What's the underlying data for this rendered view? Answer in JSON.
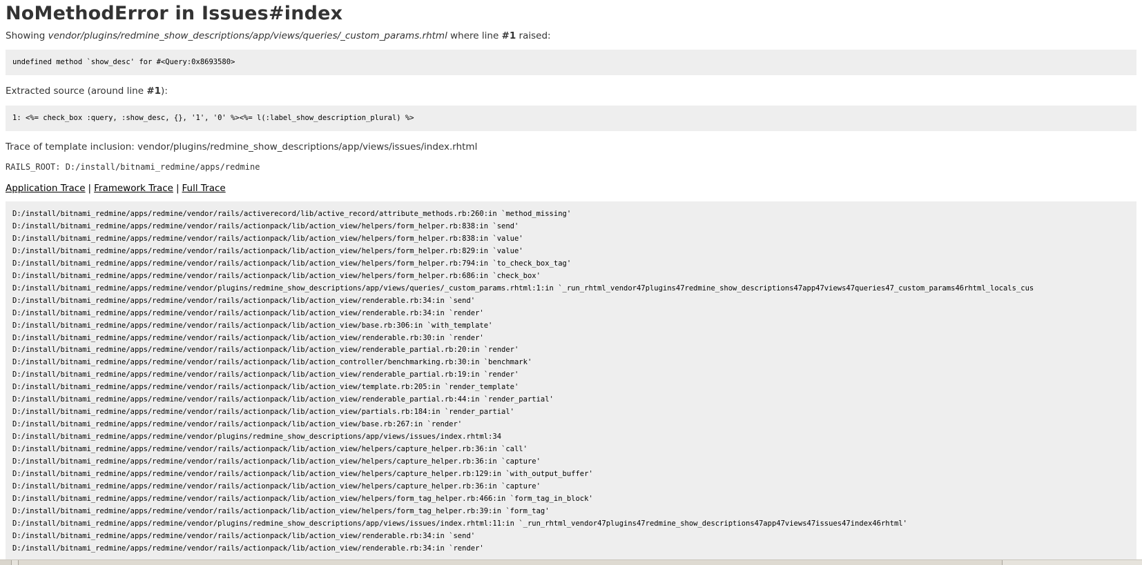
{
  "title": "NoMethodError in Issues#index",
  "showing": {
    "prefix": "Showing ",
    "path": "vendor/plugins/redmine_show_descriptions/app/views/queries/_custom_params.rhtml",
    "middle": " where line ",
    "line_no": "#1",
    "suffix": " raised:"
  },
  "error_message": "undefined method `show_desc' for #<Query:0x8693580>",
  "extracted": {
    "prefix": "Extracted source (around line ",
    "line_no": "#1",
    "suffix": "):"
  },
  "source_line": "1: <%= check_box :query, :show_desc, {}, '1', '0' %><%= l(:label_show_description_plural) %>",
  "template_inclusion": "Trace of template inclusion: vendor/plugins/redmine_show_descriptions/app/views/issues/index.rhtml",
  "rails_root": "RAILS_ROOT: D:/install/bitnami_redmine/apps/redmine",
  "links": {
    "application": "Application Trace",
    "framework": "Framework Trace",
    "full": "Full Trace",
    "separator": "|"
  },
  "trace": [
    "D:/install/bitnami_redmine/apps/redmine/vendor/rails/activerecord/lib/active_record/attribute_methods.rb:260:in `method_missing'",
    "D:/install/bitnami_redmine/apps/redmine/vendor/rails/actionpack/lib/action_view/helpers/form_helper.rb:838:in `send'",
    "D:/install/bitnami_redmine/apps/redmine/vendor/rails/actionpack/lib/action_view/helpers/form_helper.rb:838:in `value'",
    "D:/install/bitnami_redmine/apps/redmine/vendor/rails/actionpack/lib/action_view/helpers/form_helper.rb:829:in `value'",
    "D:/install/bitnami_redmine/apps/redmine/vendor/rails/actionpack/lib/action_view/helpers/form_helper.rb:794:in `to_check_box_tag'",
    "D:/install/bitnami_redmine/apps/redmine/vendor/rails/actionpack/lib/action_view/helpers/form_helper.rb:686:in `check_box'",
    "D:/install/bitnami_redmine/apps/redmine/vendor/plugins/redmine_show_descriptions/app/views/queries/_custom_params.rhtml:1:in `_run_rhtml_vendor47plugins47redmine_show_descriptions47app47views47queries47_custom_params46rhtml_locals_cus",
    "D:/install/bitnami_redmine/apps/redmine/vendor/rails/actionpack/lib/action_view/renderable.rb:34:in `send'",
    "D:/install/bitnami_redmine/apps/redmine/vendor/rails/actionpack/lib/action_view/renderable.rb:34:in `render'",
    "D:/install/bitnami_redmine/apps/redmine/vendor/rails/actionpack/lib/action_view/base.rb:306:in `with_template'",
    "D:/install/bitnami_redmine/apps/redmine/vendor/rails/actionpack/lib/action_view/renderable.rb:30:in `render'",
    "D:/install/bitnami_redmine/apps/redmine/vendor/rails/actionpack/lib/action_view/renderable_partial.rb:20:in `render'",
    "D:/install/bitnami_redmine/apps/redmine/vendor/rails/actionpack/lib/action_controller/benchmarking.rb:30:in `benchmark'",
    "D:/install/bitnami_redmine/apps/redmine/vendor/rails/actionpack/lib/action_view/renderable_partial.rb:19:in `render'",
    "D:/install/bitnami_redmine/apps/redmine/vendor/rails/actionpack/lib/action_view/template.rb:205:in `render_template'",
    "D:/install/bitnami_redmine/apps/redmine/vendor/rails/actionpack/lib/action_view/renderable_partial.rb:44:in `render_partial'",
    "D:/install/bitnami_redmine/apps/redmine/vendor/rails/actionpack/lib/action_view/partials.rb:184:in `render_partial'",
    "D:/install/bitnami_redmine/apps/redmine/vendor/rails/actionpack/lib/action_view/base.rb:267:in `render'",
    "D:/install/bitnami_redmine/apps/redmine/vendor/plugins/redmine_show_descriptions/app/views/issues/index.rhtml:34",
    "D:/install/bitnami_redmine/apps/redmine/vendor/rails/actionpack/lib/action_view/helpers/capture_helper.rb:36:in `call'",
    "D:/install/bitnami_redmine/apps/redmine/vendor/rails/actionpack/lib/action_view/helpers/capture_helper.rb:36:in `capture'",
    "D:/install/bitnami_redmine/apps/redmine/vendor/rails/actionpack/lib/action_view/helpers/capture_helper.rb:129:in `with_output_buffer'",
    "D:/install/bitnami_redmine/apps/redmine/vendor/rails/actionpack/lib/action_view/helpers/capture_helper.rb:36:in `capture'",
    "D:/install/bitnami_redmine/apps/redmine/vendor/rails/actionpack/lib/action_view/helpers/form_tag_helper.rb:466:in `form_tag_in_block'",
    "D:/install/bitnami_redmine/apps/redmine/vendor/rails/actionpack/lib/action_view/helpers/form_tag_helper.rb:39:in `form_tag'",
    "D:/install/bitnami_redmine/apps/redmine/vendor/plugins/redmine_show_descriptions/app/views/issues/index.rhtml:11:in `_run_rhtml_vendor47plugins47redmine_show_descriptions47app47views47issues47index46rhtml'",
    "D:/install/bitnami_redmine/apps/redmine/vendor/rails/actionpack/lib/action_view/renderable.rb:34:in `send'",
    "D:/install/bitnami_redmine/apps/redmine/vendor/rails/actionpack/lib/action_view/renderable.rb:34:in `render'"
  ]
}
